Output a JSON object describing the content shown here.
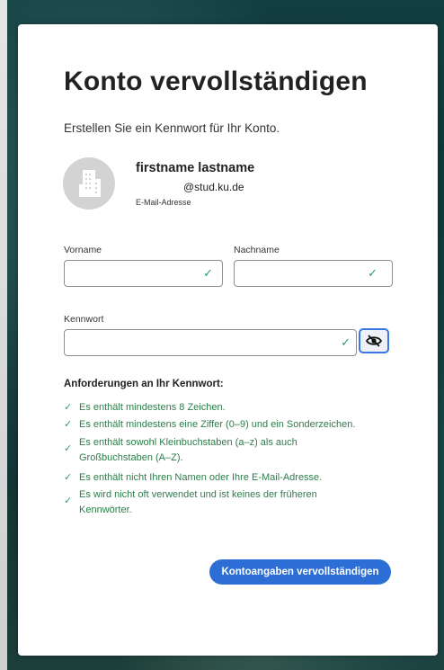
{
  "page": {
    "title": "Konto vervollständigen",
    "subtitle": "Erstellen Sie ein Kennwort für Ihr Konto."
  },
  "user": {
    "name": "firstname lastname",
    "email": "@stud.ku.de",
    "email_label": "E-Mail-Adresse"
  },
  "form": {
    "first_name_label": "Vorname",
    "first_name_value": "",
    "last_name_label": "Nachname",
    "last_name_value": "",
    "password_label": "Kennwort",
    "password_value": "",
    "valid_icon": "check-icon",
    "visibility_icon": "eye-slash-icon"
  },
  "requirements": {
    "title": "Anforderungen an Ihr Kennwort:",
    "items": [
      "Es enthält mindestens 8 Zeichen.",
      "Es enthält mindestens eine Ziffer (0–9) und ein Sonderzeichen.",
      "Es enthält sowohl Kleinbuchstaben (a–z) als auch Großbuchstaben (A–Z).",
      "Es enthält nicht Ihren Namen oder Ihre E-Mail-Adresse.",
      "Es wird nicht oft verwendet und ist keines der früheren Kennwörter."
    ]
  },
  "submit_label": "Kontoangaben vervollständigen",
  "colors": {
    "accent": "#2c6ed5",
    "success": "#2d9d60",
    "focus": "#3b78e7"
  }
}
